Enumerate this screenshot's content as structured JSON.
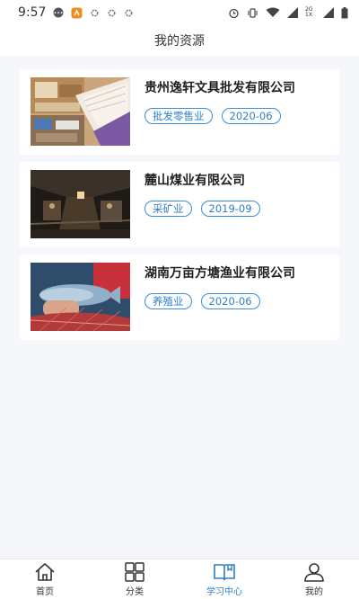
{
  "status_bar": {
    "time": "9:57",
    "network_badge": "2G 1X"
  },
  "navbar": {
    "title": "我的资源"
  },
  "resources": [
    {
      "name": "贵州逸轩文具批发有限公司",
      "industry": "批发零售业",
      "date": "2020-06",
      "image_icon": "stationery-image"
    },
    {
      "name": "麓山煤业有限公司",
      "industry": "采矿业",
      "date": "2019-09",
      "image_icon": "coal-mine-image"
    },
    {
      "name": "湖南万亩方塘渔业有限公司",
      "industry": "养殖业",
      "date": "2020-06",
      "image_icon": "fishing-image"
    }
  ],
  "tabbar": {
    "items": [
      {
        "label": "首页",
        "icon": "home-icon"
      },
      {
        "label": "分类",
        "icon": "grid-icon"
      },
      {
        "label": "学习中心",
        "icon": "book-icon",
        "active": true
      },
      {
        "label": "我的",
        "icon": "user-icon"
      }
    ],
    "active_color": "#2f7fc8"
  },
  "colors": {
    "tag_border": "#3b8ed8",
    "background": "#f6f7fb"
  }
}
